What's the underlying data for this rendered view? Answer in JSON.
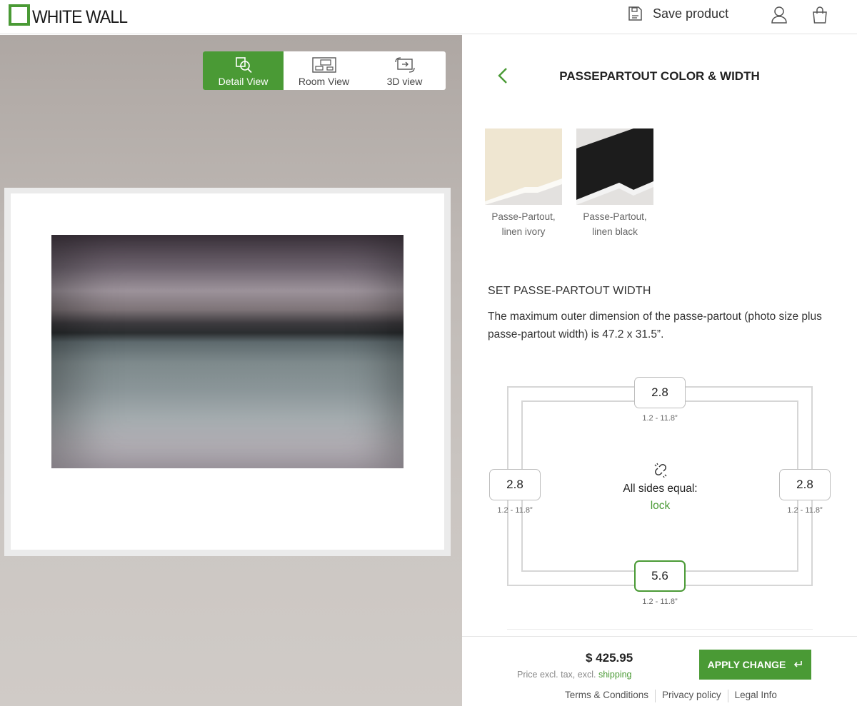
{
  "header": {
    "logo_text": "WHITE WALL",
    "save_label": "Save product",
    "icons": [
      "save-icon",
      "user-icon",
      "shopping-bag-icon"
    ]
  },
  "preview": {
    "view_tabs": [
      {
        "label": "Detail View",
        "icon": "detail-view-icon",
        "active": true
      },
      {
        "label": "Room View",
        "icon": "room-view-icon",
        "active": false
      },
      {
        "label": "3D view",
        "icon": "3d-view-icon",
        "active": false
      }
    ]
  },
  "panel": {
    "title": "PASSEPARTOUT COLOR & WIDTH",
    "swatches": [
      {
        "line1": "Passe-Partout,",
        "line2": "linen ivory",
        "color": "#ece3cf"
      },
      {
        "line1": "Passe-Partout,",
        "line2": "linen black",
        "color": "#1c1c1c"
      }
    ],
    "section_title": "SET PASSE-PARTOUT WIDTH",
    "description": "The maximum outer dimension of the passe-partout (photo size plus passe-partout width) is 47.2 x 31.5”.",
    "widths": {
      "top": "2.8",
      "left": "2.8",
      "right": "2.8",
      "bottom": "5.6"
    },
    "range_label": "1.2 - 11.8”",
    "lock_text": "All sides equal:",
    "lock_link": "lock"
  },
  "footer": {
    "price": "$ 425.95",
    "price_note": "Price excl. tax, excl.",
    "shipping_link": "shipping",
    "apply_label": "APPLY CHANGE",
    "links": [
      "Terms & Conditions",
      "Privacy policy",
      "Legal Info"
    ]
  },
  "colors": {
    "accent": "#4a9a35"
  }
}
